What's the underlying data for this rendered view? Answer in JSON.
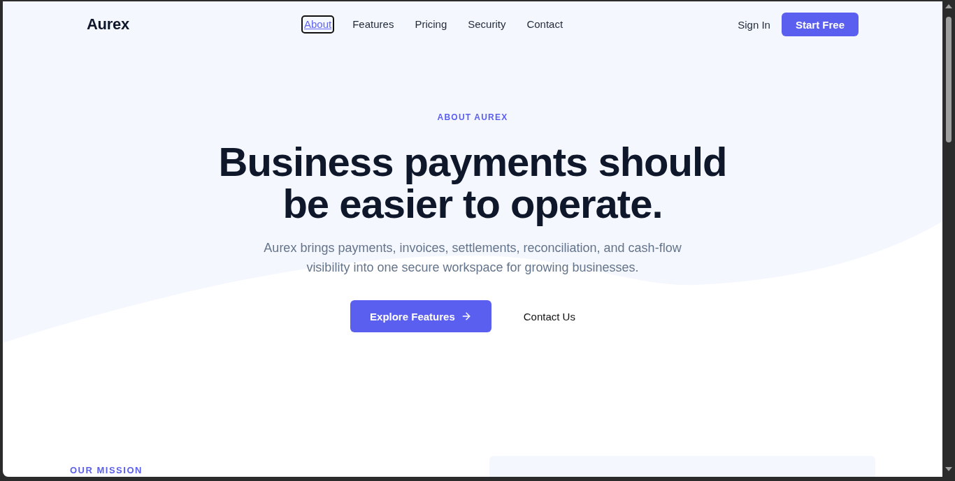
{
  "nav": {
    "logo": "Aurex",
    "links": [
      {
        "label": "About",
        "selected": true
      },
      {
        "label": "Features",
        "selected": false
      },
      {
        "label": "Pricing",
        "selected": false
      },
      {
        "label": "Security",
        "selected": false
      },
      {
        "label": "Contact",
        "selected": false
      }
    ],
    "sign_in": "Sign In",
    "cta": "Start Free"
  },
  "hero": {
    "eyebrow": "ABOUT AUREX",
    "heading": "Business payments should be easier to operate.",
    "lead": "Aurex brings payments, invoices, settlements, reconciliation, and cash-flow visibility into one secure workspace for growing businesses.",
    "buttons": [
      {
        "kind": "primary",
        "label": "Explore Features"
      },
      {
        "kind": "text",
        "label": "Contact Us"
      }
    ]
  },
  "mission": {
    "eyebrow": "OUR MISSION"
  }
}
